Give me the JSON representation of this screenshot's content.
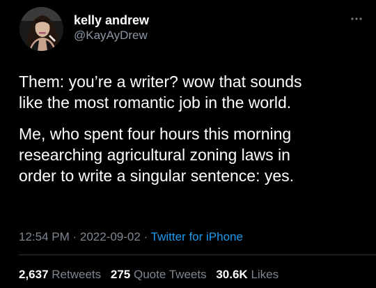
{
  "author": {
    "display_name": "kelly andrew",
    "handle": "@KayAyDrew",
    "avatar_icon": "profile-photo"
  },
  "more_icon": "more-horizontal-icon",
  "tweet": {
    "paragraphs": [
      "Them: you’re a writer? wow that sounds\nlike the most romantic job in the world.",
      "Me, who spent four hours this morning\nresearching agricultural zoning laws in\norder to write a singular sentence: yes."
    ]
  },
  "meta": {
    "time": "12:54 PM",
    "separator": " · ",
    "date": "2022-09-02",
    "source": "Twitter for iPhone"
  },
  "stats": [
    {
      "count": "2,637",
      "label": "Retweets"
    },
    {
      "count": "275",
      "label": "Quote Tweets"
    },
    {
      "count": "30.6K",
      "label": "Likes"
    }
  ],
  "colors": {
    "background": "#000000",
    "text_primary": "#ffffff",
    "text_secondary": "#7c8791",
    "accent": "#1d9bf0",
    "divider": "#2f3336"
  }
}
